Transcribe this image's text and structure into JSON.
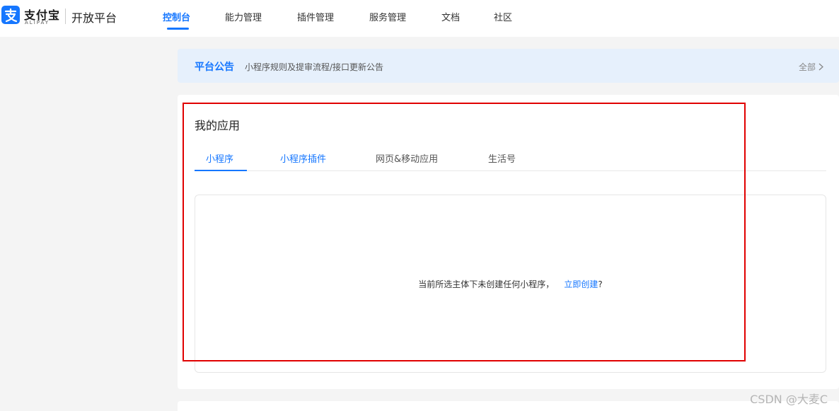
{
  "brand": {
    "logo_cn": "支付宝",
    "logo_en": "ALIPAY",
    "platform_name": "开放平台"
  },
  "nav": {
    "items": [
      {
        "label": "控制台",
        "active": true
      },
      {
        "label": "能力管理",
        "active": false
      },
      {
        "label": "插件管理",
        "active": false
      },
      {
        "label": "服务管理",
        "active": false
      },
      {
        "label": "文档",
        "active": false
      },
      {
        "label": "社区",
        "active": false
      }
    ]
  },
  "announcement": {
    "title": "平台公告",
    "text": "小程序规则及提审流程/接口更新公告",
    "all_label": "全部"
  },
  "apps": {
    "title": "我的应用",
    "tabs": [
      {
        "label": "小程序",
        "active": true
      },
      {
        "label": "小程序插件",
        "active": false
      },
      {
        "label": "网页&移动应用",
        "active": false
      },
      {
        "label": "生活号",
        "active": false
      }
    ],
    "empty_text": "当前所选主体下未创建任何小程序，",
    "create_link": "立即创建",
    "create_suffix": "?"
  },
  "watermark": "CSDN @大麦C",
  "colors": {
    "accent": "#1677ff",
    "announce_bg": "#e6f0fc",
    "page_bg": "#f4f4f4",
    "highlight": "#e00000"
  },
  "icons": {
    "logo": "alipay-logo-icon",
    "chevron": "chevron-right-icon"
  }
}
